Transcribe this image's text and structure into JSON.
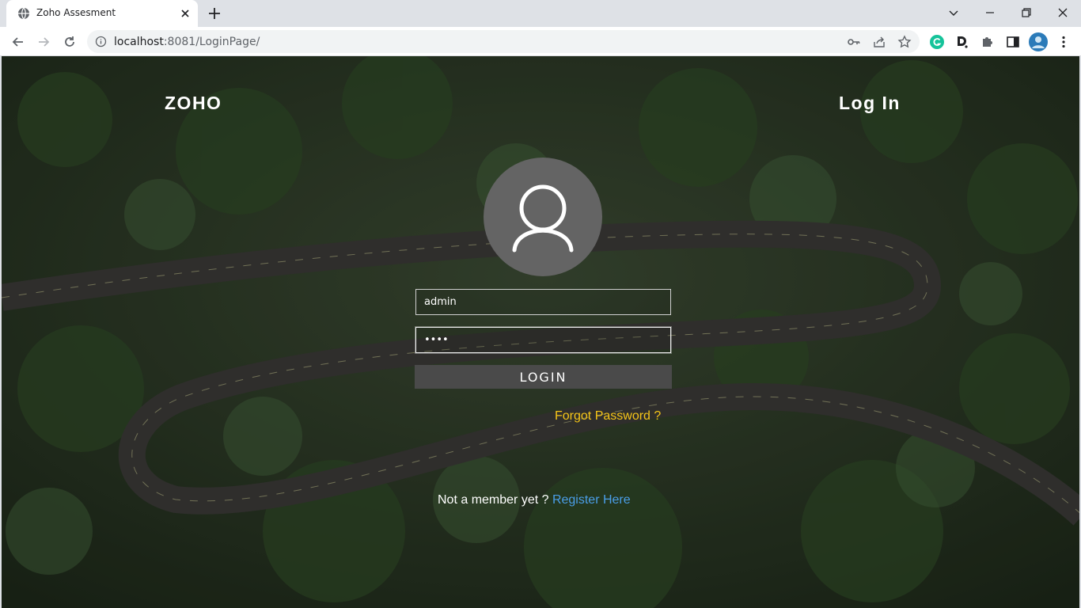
{
  "browser": {
    "tab_title": "Zoho Assesment",
    "url_host": "localhost",
    "url_rest": ":8081/LoginPage/",
    "icons": [
      "globe-icon",
      "close-icon",
      "plus-icon",
      "chevron-down-icon",
      "minimize-icon",
      "restore-icon",
      "close-window-icon",
      "back-arrow-icon",
      "forward-arrow-icon",
      "reload-icon",
      "info-icon",
      "key-icon",
      "share-icon",
      "star-icon",
      "grammarly-icon",
      "dashlane-icon",
      "puzzle-icon",
      "side-panel-icon",
      "profile-avatar",
      "kebab-menu-icon"
    ]
  },
  "page": {
    "brand": "ZOHO",
    "heading": "Log In",
    "username_value": "admin",
    "password_value": "••••",
    "login_label": "LOGIN",
    "forgot_label": "Forgot Password ?",
    "member_text": "Not a member yet ? ",
    "register_label": "Register Here"
  },
  "colors": {
    "forgot_link": "#f5c518",
    "register_link": "#4a9ee8",
    "login_button": "#4a4a4a",
    "avatar_bg": "#646464"
  }
}
